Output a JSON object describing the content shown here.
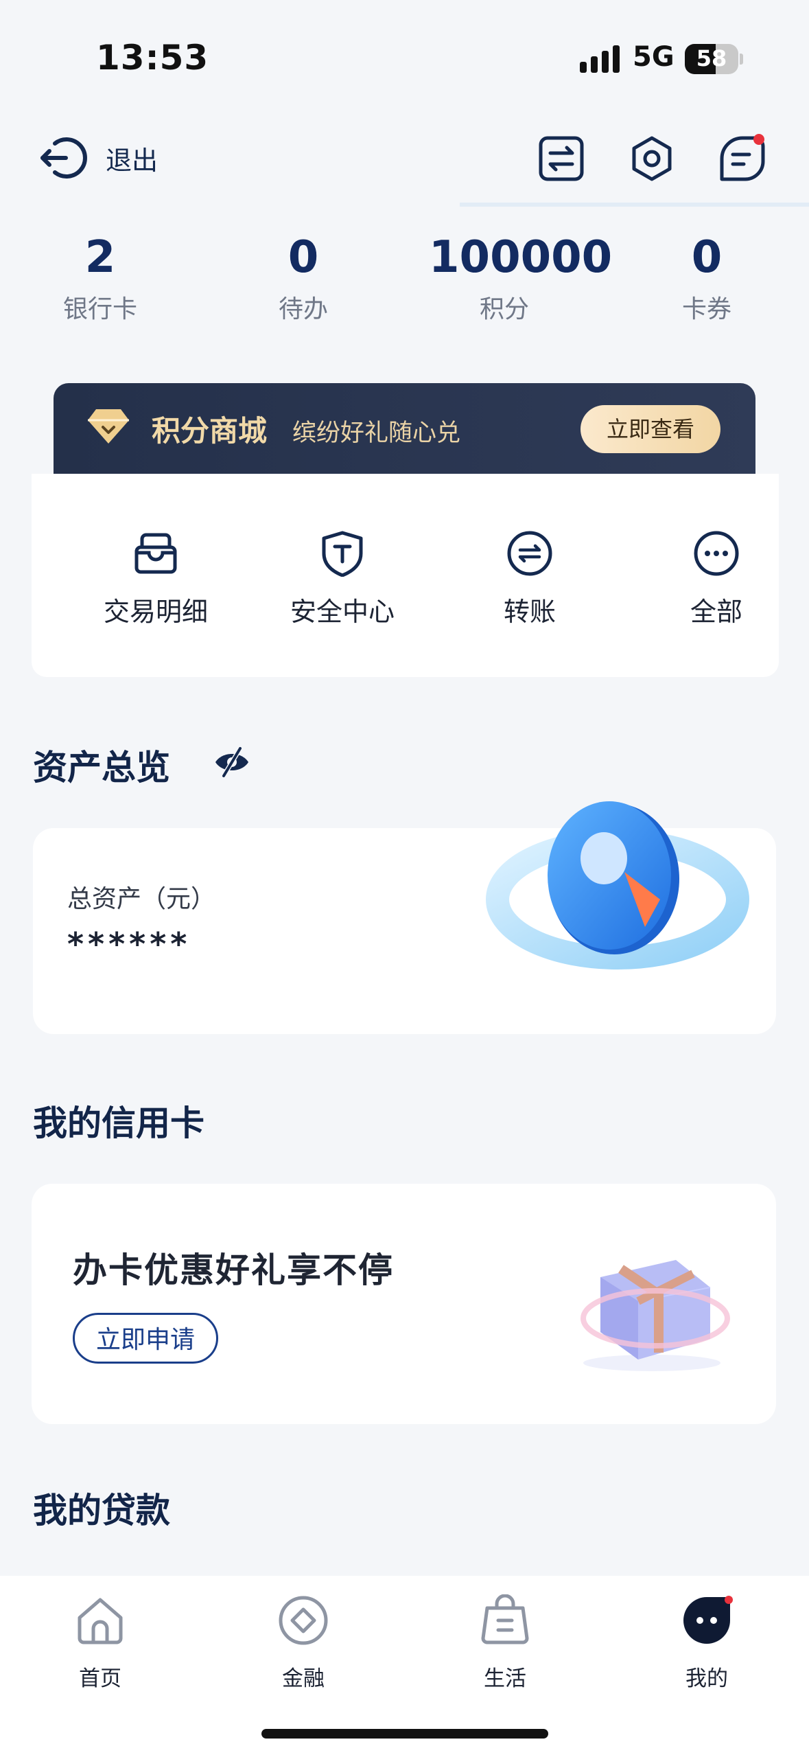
{
  "status_bar": {
    "time": "13:53",
    "network": "5G",
    "battery": "58",
    "battery_level": 0.58
  },
  "header": {
    "logout_label": "退出"
  },
  "stats": [
    {
      "value": "2",
      "label": "银行卡"
    },
    {
      "value": "0",
      "label": "待办"
    },
    {
      "value": "100000",
      "label": "积分"
    },
    {
      "value": "0",
      "label": "卡券"
    }
  ],
  "mall": {
    "title": "积分商城",
    "subtitle": "缤纷好礼随心兑",
    "button": "立即查看"
  },
  "quick_actions": [
    {
      "label": "交易明细",
      "icon": "inbox-icon"
    },
    {
      "label": "安全中心",
      "icon": "shield-icon"
    },
    {
      "label": "转账",
      "icon": "transfer-icon"
    },
    {
      "label": "全部",
      "icon": "more-icon"
    }
  ],
  "assets": {
    "title": "资产总览",
    "label": "总资产（元）",
    "value": "******",
    "toggle_icon": "eye-hidden-icon"
  },
  "credit_card": {
    "title": "我的信用卡",
    "promo": "办卡优惠好礼享不停",
    "button": "立即申请"
  },
  "loans": {
    "title": "我的贷款"
  },
  "tabbar": [
    {
      "label": "首页",
      "icon": "home-icon"
    },
    {
      "label": "金融",
      "icon": "finance-icon"
    },
    {
      "label": "生活",
      "icon": "life-icon"
    },
    {
      "label": "我的",
      "icon": "profile-icon",
      "active": true
    }
  ],
  "colors": {
    "primary": "#122549",
    "accent": "#1a3e8a",
    "mall_bg": "#24304a",
    "gold": "#f1d9a8",
    "notification": "#e8323c"
  }
}
